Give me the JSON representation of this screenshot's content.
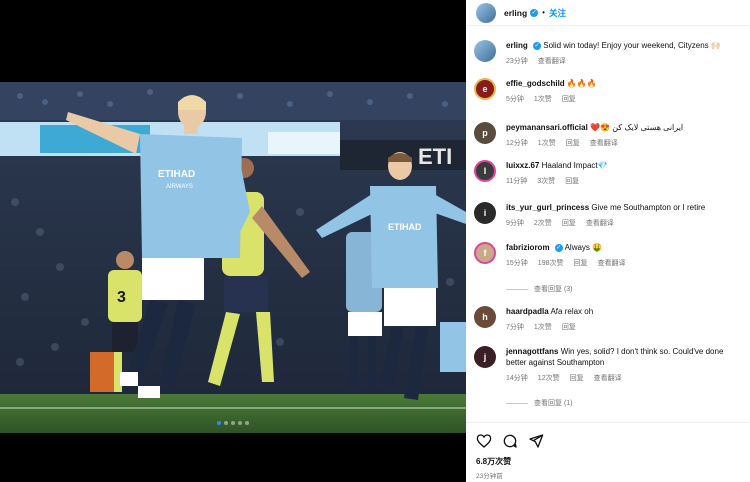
{
  "post": {
    "username": "erling",
    "follow_label": "关注",
    "separator": "•",
    "carousel_count": 5,
    "carousel_active": 1,
    "shirt_sponsor": "ETIHAD",
    "shirt_sponsor_sub": "AIRWAYS",
    "shirt_number": "3",
    "board_text": "ETI"
  },
  "caption": {
    "username": "erling",
    "text": "Solid win today! Enjoy your weekend, Cityzens 🙌🏻",
    "time": "23分钟",
    "translate": "查看翻译"
  },
  "comments": [
    {
      "username": "effie_godschild",
      "text": "🔥🔥🔥",
      "time": "5分钟",
      "likes": "1次赞",
      "reply": "回复",
      "verified": false,
      "avatar_color": "#8b1a1a",
      "avatar_letter": "e"
    },
    {
      "username": "peymanansari.official",
      "text": "❤️😍 ایرانی هستی لایک کن",
      "time": "12分钟",
      "likes": "1次赞",
      "reply": "回复",
      "translate": "查看翻译",
      "verified": false,
      "avatar_color": "#5a4b3f",
      "avatar_letter": "p"
    },
    {
      "username": "luixxz.67",
      "text": "Haaland Impact💎",
      "time": "11分钟",
      "likes": "3次赞",
      "reply": "回复",
      "verified": false,
      "avatar_color": "#3b3b3b",
      "avatar_letter": "l"
    },
    {
      "username": "its_yur_gurl_princess",
      "text": "Give me Southampton or I retire",
      "time": "9分钟",
      "likes": "2次赞",
      "reply": "回复",
      "translate": "查看翻译",
      "verified": false,
      "avatar_color": "#2a2a2a",
      "avatar_letter": "i"
    },
    {
      "username": "fabriziorom",
      "text": "Always 🤑",
      "time": "15分钟",
      "likes": "198次赞",
      "reply": "回复",
      "translate": "查看翻译",
      "verified": true,
      "avatar_color": "#c9a98a",
      "avatar_letter": "f",
      "replies": "查看回复 (3)"
    },
    {
      "username": "haardpadla",
      "text": "Afa relax oh",
      "time": "7分钟",
      "likes": "1次赞",
      "reply": "回复",
      "verified": false,
      "avatar_color": "#6b4a3a",
      "avatar_letter": "h"
    },
    {
      "username": "jennagottfans",
      "text": "Win yes, solid? I don't think so. Could've done better against Southampton",
      "time": "14分钟",
      "likes": "12次赞",
      "reply": "回复",
      "translate": "查看翻译",
      "verified": false,
      "avatar_color": "#3a1f26",
      "avatar_letter": "j",
      "replies": "查看回复 (1)"
    }
  ],
  "footer": {
    "likes": "6.8万次赞",
    "time": "23分钟前"
  },
  "colors": {
    "accent": "#0095f6",
    "verified": "#1d9bf0",
    "secondary_text": "#737373"
  }
}
